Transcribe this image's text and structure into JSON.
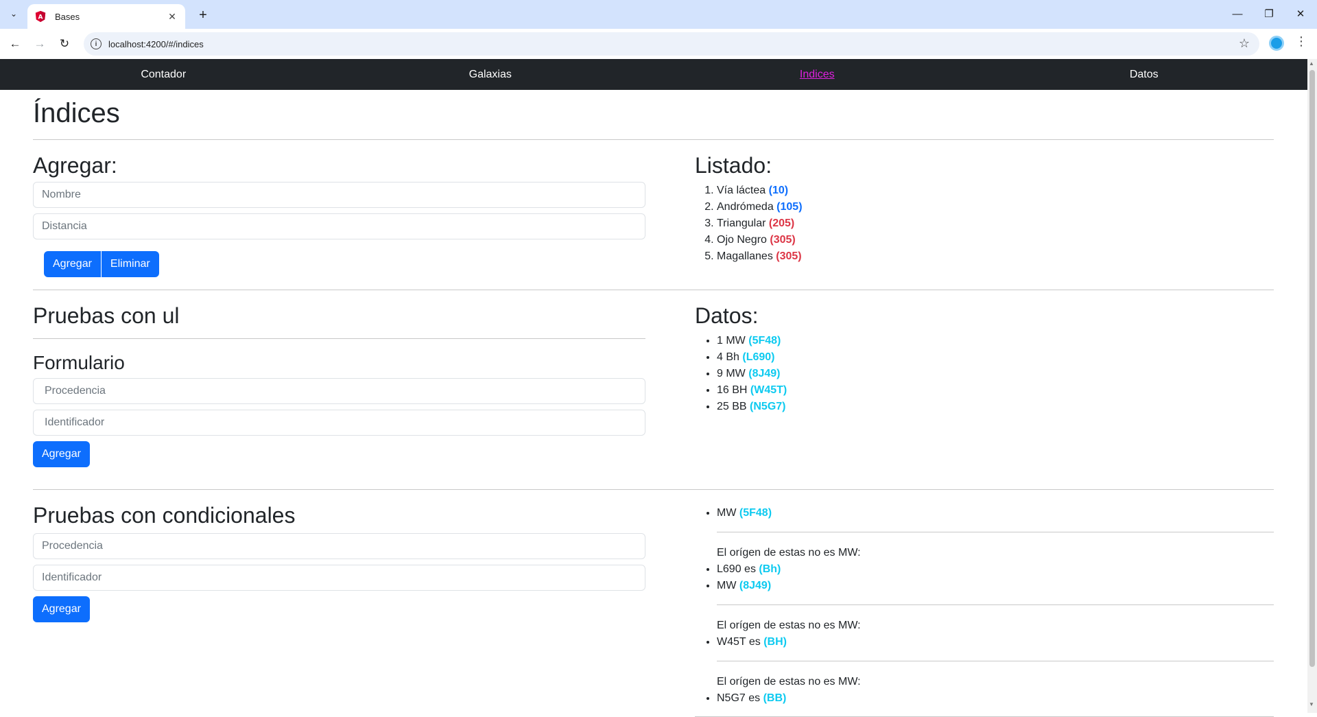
{
  "browser": {
    "tab_title": "Bases",
    "url": "localhost:4200/#/indices"
  },
  "nav": {
    "items": [
      "Contador",
      "Galaxias",
      "Indices",
      "Datos"
    ],
    "active": "Indices"
  },
  "page": {
    "title": "Índices",
    "agregar": {
      "heading": "Agregar:",
      "nombre_placeholder": "Nombre",
      "distancia_placeholder": "Distancia",
      "agregar_btn": "Agregar",
      "eliminar_btn": "Eliminar"
    },
    "listado": {
      "heading": "Listado:",
      "items": [
        {
          "name": "Vía láctea",
          "value": "(10)",
          "color": "blue"
        },
        {
          "name": "Andrómeda",
          "value": "(105)",
          "color": "blue"
        },
        {
          "name": "Triangular",
          "value": "(205)",
          "color": "red"
        },
        {
          "name": "Ojo Negro",
          "value": "(305)",
          "color": "red"
        },
        {
          "name": "Magallanes",
          "value": "(305)",
          "color": "red"
        }
      ]
    },
    "pruebas_ul": {
      "heading": "Pruebas con ul",
      "form_heading": "Formulario",
      "procedencia_placeholder": "Procedencia",
      "identificador_placeholder": "Identificador",
      "agregar_btn": "Agregar"
    },
    "datos": {
      "heading": "Datos:",
      "items": [
        {
          "text": "1 MW",
          "code": "(5F48)"
        },
        {
          "text": "4 Bh",
          "code": "(L690)"
        },
        {
          "text": "9 MW",
          "code": "(8J49)"
        },
        {
          "text": "16 BH",
          "code": "(W45T)"
        },
        {
          "text": "25 BB",
          "code": "(N5G7)"
        }
      ]
    },
    "pruebas_cond": {
      "heading": "Pruebas con condicionales",
      "procedencia_placeholder": "Procedencia",
      "identificador_placeholder": "Identificador",
      "agregar_btn": "Agregar"
    },
    "condicionales": {
      "first": {
        "text": "MW",
        "code": "(5F48)"
      },
      "note": "El orígen de estas no es MW:",
      "group1": [
        {
          "text": "L690 es",
          "code": "(Bh)"
        },
        {
          "text": "MW",
          "code": "(8J49)"
        }
      ],
      "group2": [
        {
          "text": "W45T es",
          "code": "(BH)"
        }
      ],
      "group3": [
        {
          "text": "N5G7 es",
          "code": "(BB)"
        }
      ]
    }
  }
}
